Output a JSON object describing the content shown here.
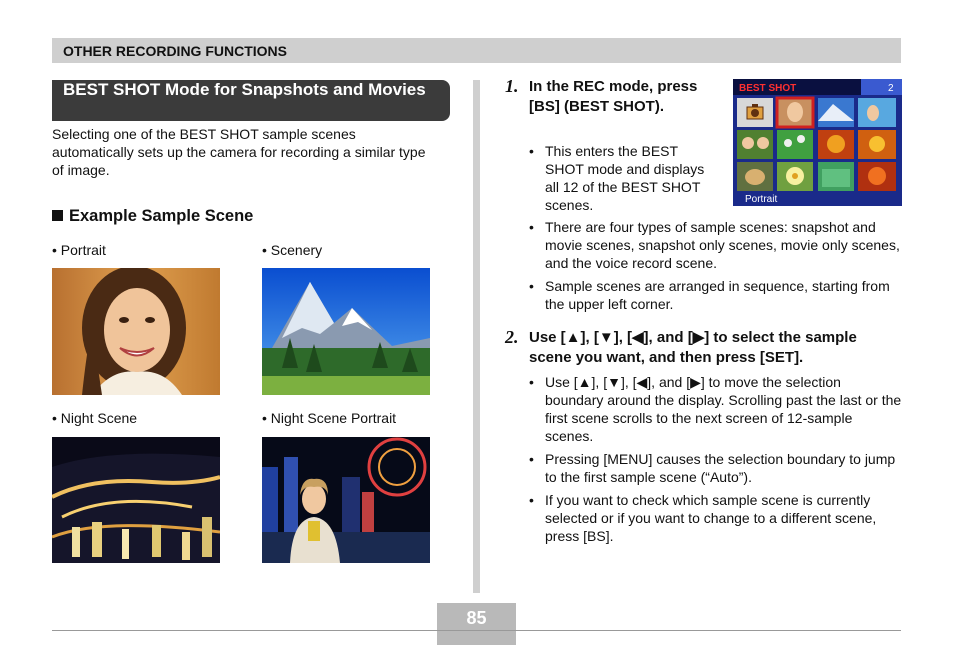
{
  "header": {
    "section_title": "OTHER RECORDING FUNCTIONS"
  },
  "left": {
    "mode_title": "BEST SHOT Mode for Snapshots and Movies",
    "intro": "Selecting one of the BEST SHOT sample scenes automatically sets up the camera for recording a similar type of image.",
    "example_heading": "Example Sample Scene",
    "samples": [
      {
        "caption": "• Portrait",
        "icon": "portrait-photo"
      },
      {
        "caption": "• Scenery",
        "icon": "scenery-photo"
      },
      {
        "caption": "• Night Scene",
        "icon": "night-scene-photo"
      },
      {
        "caption": "• Night Scene Portrait",
        "icon": "night-portrait-photo"
      }
    ]
  },
  "right": {
    "step1": {
      "num": "1.",
      "text": "In the REC mode, press [BS] (BEST SHOT).",
      "bullets": [
        "This enters the BEST SHOT mode and displays all 12 of the BEST SHOT scenes.",
        "There are four types of sample scenes: snapshot and movie scenes, snapshot only scenes, movie only scenes, and the voice record scene.",
        "Sample scenes are arranged in sequence, starting from the upper left corner."
      ]
    },
    "step2": {
      "num": "2.",
      "text": "Use [▲], [▼], [◀], and [▶] to select the sample scene you want, and then press [SET].",
      "bullets": [
        "Use [▲], [▼], [◀], and [▶] to move the selection boundary around the display. Scrolling past the last or the first scene scrolls to the next screen of 12-sample scenes.",
        "Pressing [MENU] causes the selection boundary to jump to the first sample scene (“Auto”).",
        "If you want to check which sample scene is currently selected or if you want to change to a different scene, press [BS]."
      ]
    },
    "lcd": {
      "title": "BEST SHOT",
      "page": "2",
      "label": "Portrait",
      "icon": "camera-icon",
      "colors": {
        "background": "#1a2a8a",
        "title": "#ff3030",
        "selection": "#d02020"
      }
    }
  },
  "footer": {
    "page_number": "85"
  }
}
